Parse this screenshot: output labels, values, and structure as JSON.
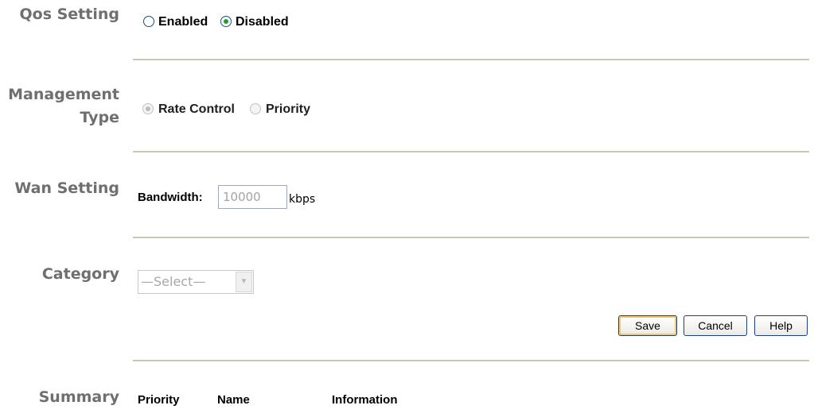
{
  "qos": {
    "label": "Qos Setting",
    "options": [
      "Enabled",
      "Disabled"
    ],
    "selected": "Disabled"
  },
  "management": {
    "label_line1": "Management",
    "label_line2": "Type",
    "options": [
      "Rate Control",
      "Priority"
    ],
    "selected": "Rate Control",
    "disabled": true
  },
  "wan": {
    "label": "Wan Setting",
    "bandwidth_label": "Bandwidth:",
    "bandwidth_value": "10000",
    "unit": "kbps"
  },
  "category": {
    "label": "Category",
    "selected": "—Select—",
    "disabled": true
  },
  "buttons": {
    "save": "Save",
    "cancel": "Cancel",
    "help": "Help"
  },
  "summary": {
    "label": "Summary",
    "columns": [
      "Priority",
      "Name",
      "Information"
    ]
  },
  "colors": {
    "divider": "#cbc6b3",
    "section_label": "#6f6f6f",
    "radio_selected": "#21a121",
    "button_border": "#1b3f85"
  }
}
